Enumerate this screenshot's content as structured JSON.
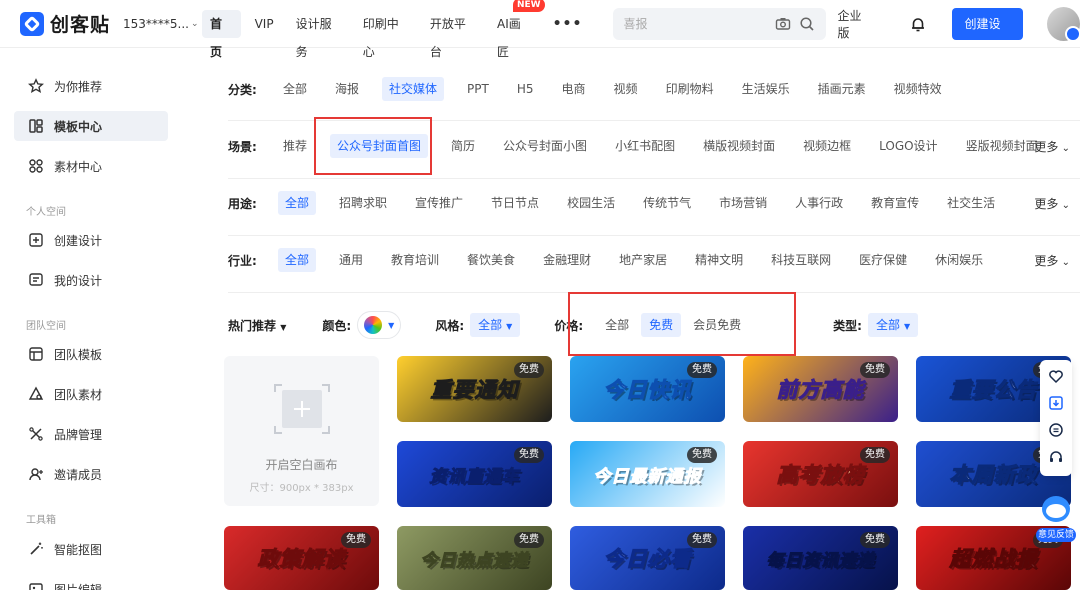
{
  "topbar": {
    "logo_text": "创客贴",
    "account": "153****5...",
    "nav": [
      {
        "label": "首页",
        "active": true
      },
      {
        "label": "VIP"
      },
      {
        "label": "设计服务"
      },
      {
        "label": "印刷中心"
      },
      {
        "label": "开放平台"
      },
      {
        "label": "AI画匠",
        "badge": "NEW"
      }
    ],
    "search_placeholder": "喜报",
    "enterprise": "企业版",
    "create_label": "创建设计"
  },
  "sidebar": {
    "items": [
      {
        "label": "为你推荐",
        "icon": "star-icon"
      },
      {
        "label": "模板中心",
        "icon": "template-icon",
        "active": true
      },
      {
        "label": "素材中心",
        "icon": "material-icon"
      }
    ],
    "section_personal": "个人空间",
    "personal_items": [
      {
        "label": "创建设计",
        "icon": "add-box-icon"
      },
      {
        "label": "我的设计",
        "icon": "my-design-icon"
      }
    ],
    "section_team": "团队空间",
    "team_items": [
      {
        "label": "团队模板",
        "icon": "team-template-icon"
      },
      {
        "label": "团队素材",
        "icon": "team-material-icon"
      },
      {
        "label": "品牌管理",
        "icon": "brand-icon"
      },
      {
        "label": "邀请成员",
        "icon": "invite-icon"
      }
    ],
    "section_tools": "工具箱",
    "tool_items": [
      {
        "label": "智能抠图",
        "icon": "magic-wand-icon"
      },
      {
        "label": "图片编辑",
        "icon": "image-edit-icon"
      }
    ]
  },
  "filters": {
    "category": {
      "label": "分类:",
      "options": [
        "全部",
        "海报",
        "社交媒体",
        "PPT",
        "H5",
        "电商",
        "视频",
        "印刷物料",
        "生活娱乐",
        "插画元素",
        "视频特效"
      ],
      "selected": 2
    },
    "scene": {
      "label": "场景:",
      "options": [
        "推荐",
        "公众号封面首图",
        "简历",
        "公众号封面小图",
        "小红书配图",
        "横版视频封面",
        "视频边框",
        "LOGO设计",
        "竖版视频封面"
      ],
      "selected": 1,
      "more": "更多"
    },
    "usage": {
      "label": "用途:",
      "options": [
        "全部",
        "招聘求职",
        "宣传推广",
        "节日节点",
        "校园生活",
        "传统节气",
        "市场营销",
        "人事行政",
        "教育宣传",
        "社交生活"
      ],
      "selected": 0,
      "more": "更多"
    },
    "industry": {
      "label": "行业:",
      "options": [
        "全部",
        "通用",
        "教育培训",
        "餐饮美食",
        "金融理财",
        "地产家居",
        "精神文明",
        "科技互联网",
        "医疗保健",
        "休闲娱乐"
      ],
      "selected": 0,
      "more": "更多"
    }
  },
  "toolbar": {
    "hot": "热门推荐",
    "color_label": "颜色:",
    "style_label": "风格:",
    "style_value": "全部",
    "price_label": "价格:",
    "price_options": [
      "全部",
      "免费",
      "会员免费"
    ],
    "price_selected": 1,
    "type_label": "类型:",
    "type_value": "全部"
  },
  "blank_canvas": {
    "title": "开启空白画布",
    "size": "尺寸：900px * 383px"
  },
  "templates": [
    {
      "title": "重要通知",
      "badge": "免费",
      "bg": "#ffcf2e",
      "fg": "#ffffff",
      "stroke": "#1d1d1d"
    },
    {
      "title": "今日快讯",
      "badge": "免费",
      "bg": "#2aa3f0",
      "fg": "#ffffff",
      "stroke": "#0d4fb0"
    },
    {
      "title": "前方高能",
      "badge": "免费",
      "bg": "#ffb21a",
      "fg": "#ffffff",
      "stroke": "#3a1f8a"
    },
    {
      "title": "重要公告",
      "badge": "免费",
      "bg": "#1a54d6",
      "fg": "#ffffff",
      "stroke": "#0a2a7a"
    },
    {
      "title": "资讯直通车",
      "badge": "免费",
      "bg": "#1e49d8",
      "fg": "#ffe23a",
      "stroke": "#0a1f6e"
    },
    {
      "title": "今日最新通报",
      "badge": "免费",
      "bg": "#27a9f5",
      "fg": "#1552c7",
      "stroke": "#ffffff"
    },
    {
      "title": "高考放榜",
      "badge": "免费",
      "bg": "#e8352e",
      "fg": "#ffe9a8",
      "stroke": "#7a0f0f"
    },
    {
      "title": "本周新政",
      "badge": "免费",
      "bg": "#1f4fd1",
      "fg": "#ffffff",
      "stroke": "#0a2a7a"
    },
    {
      "title": "政策解读",
      "badge": "免费",
      "bg": "#d92a2a",
      "fg": "#ffffff",
      "stroke": "#6e0b0b"
    },
    {
      "title": "今日热点速递",
      "badge": "免费",
      "bg": "#8e9a63",
      "fg": "#fff6d6",
      "stroke": "#3d4422"
    },
    {
      "title": "今日必看",
      "badge": "免费",
      "bg": "#2f5de0",
      "fg": "#ffffff",
      "stroke": "#0d2a8a"
    },
    {
      "title": "每日资讯速递",
      "badge": "免费",
      "bg": "#1a2fa8",
      "fg": "#ffffff",
      "stroke": "#06124a"
    },
    {
      "title": "超燃战报",
      "badge": "免费",
      "bg": "#e0201f",
      "fg": "#ffffff",
      "stroke": "#5a0606"
    }
  ],
  "float": {
    "feedback": "意见反馈"
  },
  "colors": {
    "accent": "#1f66ff",
    "selected_bg": "#e8effe",
    "highlight_box": "#e53935"
  }
}
